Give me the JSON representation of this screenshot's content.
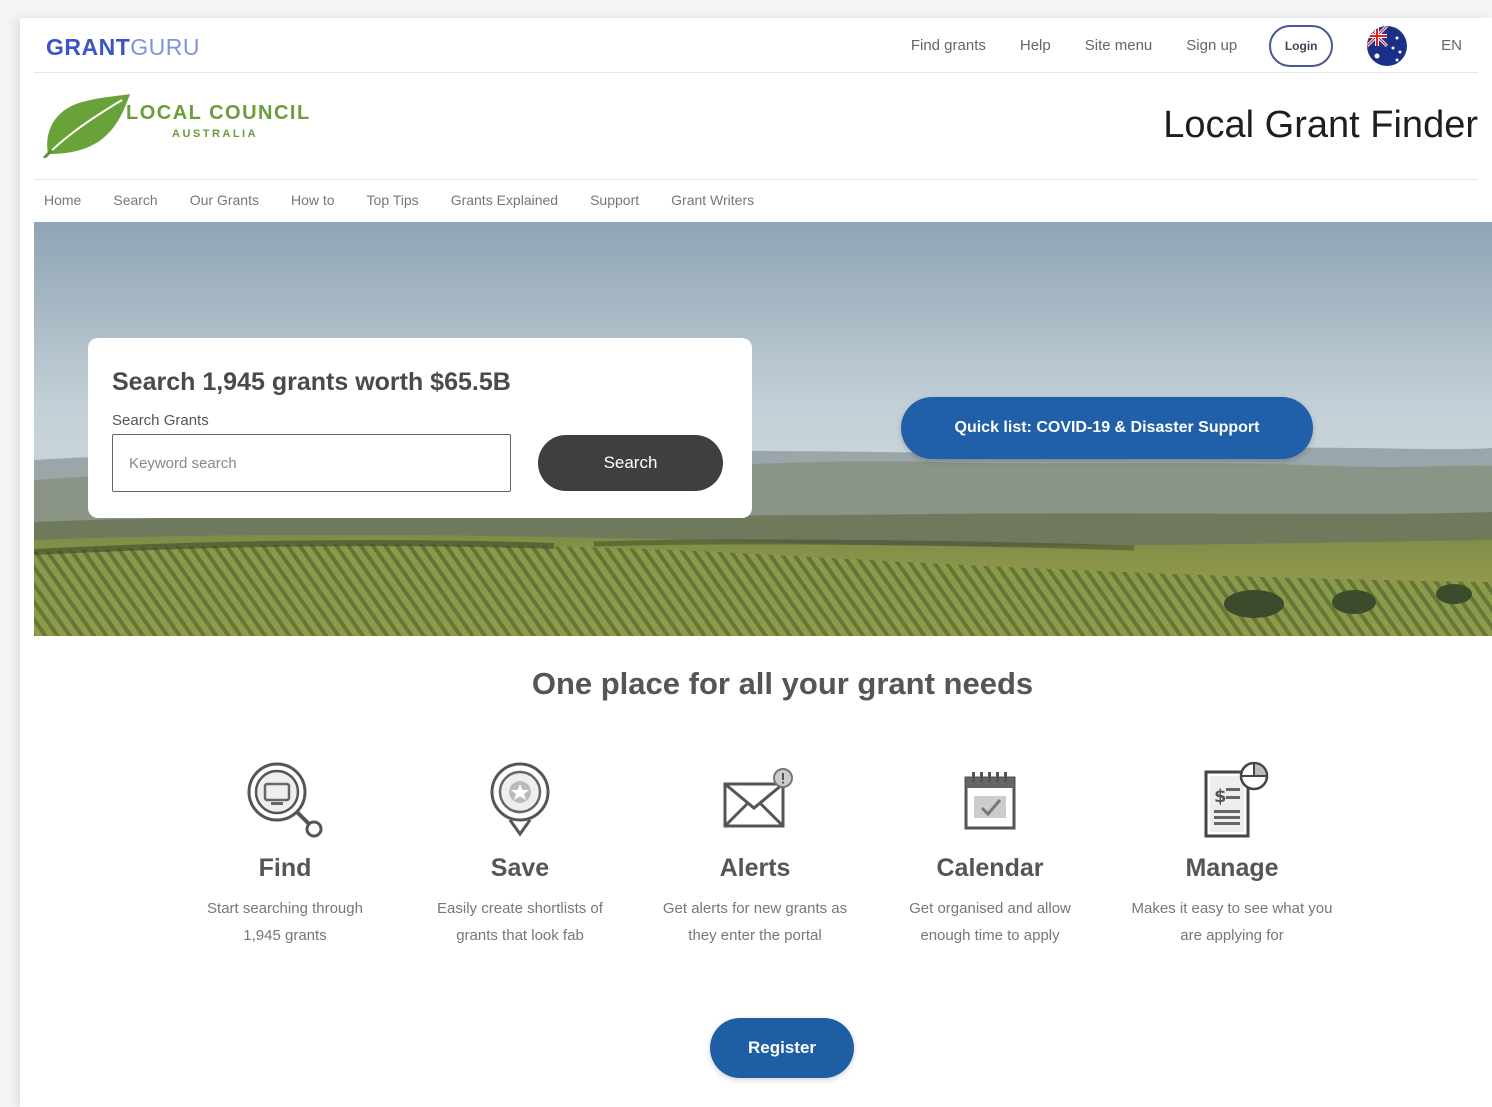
{
  "brand": {
    "part1": "GRANT",
    "part2": "GURU"
  },
  "topnav": {
    "links": [
      "Find grants",
      "Help",
      "Site menu",
      "Sign up"
    ],
    "login_label": "Login",
    "flag_icon": "australia-flag-icon",
    "language": "EN"
  },
  "header": {
    "logo_line1": "LOCAL COUNCIL",
    "logo_line2": "AUSTRALIA",
    "title": "Local Grant Finder"
  },
  "subnav": {
    "items": [
      "Home",
      "Search",
      "Our Grants",
      "How to",
      "Top Tips",
      "Grants Explained",
      "Support",
      "Grant Writers"
    ]
  },
  "hero": {
    "search_title": "Search 1,945 grants worth $65.5B",
    "search_label": "Search Grants",
    "search_placeholder": "Keyword search",
    "search_button": "Search",
    "quick_list_button": "Quick list: COVID-19 & Disaster Support"
  },
  "features": {
    "title": "One place for all your grant needs",
    "items": [
      {
        "icon": "magnifier-icon",
        "name": "Find",
        "desc_line1": "Start searching through",
        "desc_line2": "1,945 grants"
      },
      {
        "icon": "badge-icon",
        "name": "Save",
        "desc_line1": "Easily create shortlists of",
        "desc_line2": "grants that look fab"
      },
      {
        "icon": "envelope-icon",
        "name": "Alerts",
        "desc_line1": "Get alerts for new grants as",
        "desc_line2": "they enter the portal"
      },
      {
        "icon": "calendar-icon",
        "name": "Calendar",
        "desc_line1": "Get organised and allow",
        "desc_line2": "enough time to apply"
      },
      {
        "icon": "report-chart-icon",
        "name": "Manage",
        "desc_line1": "Makes it easy to see what you",
        "desc_line2": "are applying for"
      }
    ]
  },
  "register_label": "Register",
  "colors": {
    "brand_blue": "#3b55c5",
    "primary_button": "#1f60a8",
    "search_button": "#3f3f3f",
    "logo_green": "#6a9e3b"
  }
}
